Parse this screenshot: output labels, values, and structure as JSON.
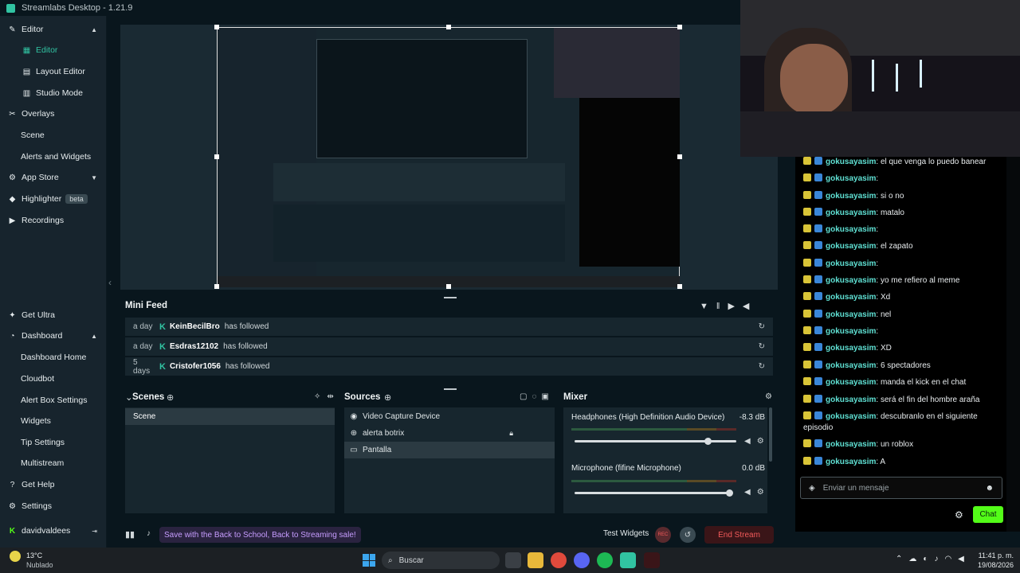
{
  "app": {
    "title": "Streamlabs Desktop - 1.21.9"
  },
  "sidebar": {
    "items": [
      {
        "label": "Editor",
        "icon": "editor-icon"
      },
      {
        "label": "Editor",
        "icon": "editor-icon"
      },
      {
        "label": "Layout Editor",
        "icon": "layout-icon"
      },
      {
        "label": "Studio Mode",
        "icon": "studio-icon"
      },
      {
        "label": "Overlays",
        "icon": "overlays-icon"
      },
      {
        "label": "Scene"
      },
      {
        "label": "Alerts and Widgets"
      },
      {
        "label": "App Store",
        "icon": "app-store-icon"
      },
      {
        "label": "Highlighter",
        "icon": "highlighter-icon",
        "badge": "beta"
      },
      {
        "label": "Recordings",
        "icon": "recordings-icon"
      }
    ],
    "bottom": [
      {
        "label": "Get Ultra"
      },
      {
        "label": "Dashboard"
      },
      {
        "label": "Dashboard Home"
      },
      {
        "label": "Cloudbot"
      },
      {
        "label": "Alert Box Settings"
      },
      {
        "label": "Widgets"
      },
      {
        "label": "Tip Settings"
      },
      {
        "label": "Multistream"
      },
      {
        "label": "Get Help"
      },
      {
        "label": "Settings"
      }
    ],
    "user": "davidvaldees"
  },
  "minifeed": {
    "title": "Mini Feed",
    "rows": [
      {
        "time": "a day",
        "name": "KeinBecilBro",
        "action": "has followed"
      },
      {
        "time": "a day",
        "name": "Esdras12102",
        "action": "has followed"
      },
      {
        "time": "5 days",
        "name": "Cristofer1056",
        "action": "has followed"
      }
    ]
  },
  "scenes": {
    "title": "Scenes",
    "items": [
      "Scene"
    ]
  },
  "sources": {
    "title": "Sources",
    "items": [
      "Video Capture Device",
      "alerta botrix",
      "Pantalla"
    ]
  },
  "mixer": {
    "title": "Mixer",
    "channels": [
      {
        "name": "Headphones (High Definition Audio Device)",
        "db": "-8.3 dB",
        "level": 0.83
      },
      {
        "name": "Microphone (fifine Microphone)",
        "db": "0.0 dB",
        "level": 1.0
      }
    ]
  },
  "footer": {
    "promo": "Save with the Back to School, Back to Streaming sale!",
    "test_widgets": "Test Widgets",
    "end_stream": "End Stream"
  },
  "chat": {
    "messages": [
      {
        "user": "gokusayasim",
        "text": "el que venga lo puedo banear"
      },
      {
        "user": "gokusayasim",
        "text": ""
      },
      {
        "user": "gokusayasim",
        "text": "si o no"
      },
      {
        "user": "gokusayasim",
        "text": "matalo"
      },
      {
        "user": "gokusayasim",
        "text": ""
      },
      {
        "user": "gokusayasim",
        "text": "el zapato"
      },
      {
        "user": "gokusayasim",
        "text": ""
      },
      {
        "user": "gokusayasim",
        "text": "yo me refiero al meme"
      },
      {
        "user": "gokusayasim",
        "text": "Xd"
      },
      {
        "user": "gokusayasim",
        "text": "nel"
      },
      {
        "user": "gokusayasim",
        "text": ""
      },
      {
        "user": "gokusayasim",
        "text": "XD"
      },
      {
        "user": "gokusayasim",
        "text": "6 spectadores"
      },
      {
        "user": "gokusayasim",
        "text": "manda el kick en el chat"
      },
      {
        "user": "gokusayasim",
        "text": "será el fin del hombre araña"
      },
      {
        "user": "gokusayasim",
        "text": "descubranlo en el siguiente episodio"
      },
      {
        "user": "gokusayasim",
        "text": "un roblox"
      },
      {
        "user": "gokusayasim",
        "text": "A"
      }
    ],
    "input_placeholder": "Enviar un mensaje",
    "send_label": "Chat"
  },
  "taskbar": {
    "weather_temp": "13°C",
    "weather_desc": "Nublado",
    "search": "Buscar",
    "time": "11:41 p. m.",
    "date": "19/08/2026"
  }
}
